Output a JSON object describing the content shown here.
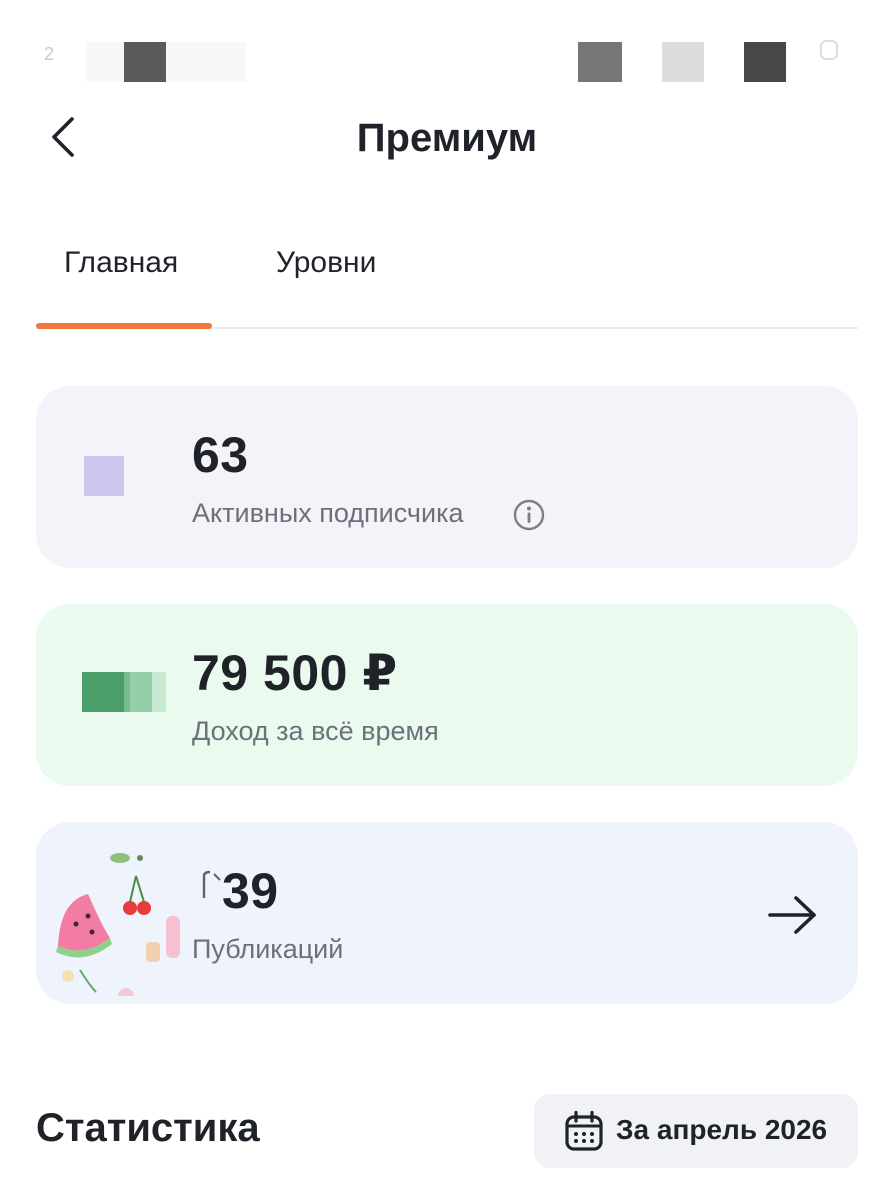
{
  "status_bar": {
    "time": "2"
  },
  "header": {
    "title": "Премиум",
    "back_icon": "chevron-left-icon"
  },
  "tabs": [
    {
      "label": "Главная",
      "active": true
    },
    {
      "label": "Уровни",
      "active": false
    }
  ],
  "accent_color": "#f0783a",
  "cards": {
    "subscribers": {
      "value": "63",
      "label": "Активных подписчика",
      "info_icon": "info-icon",
      "bg_color": "#f3f3f9"
    },
    "income": {
      "value": "79 500 ₽",
      "label": "Доход за всё время",
      "bg_color": "#eafaee"
    },
    "publications": {
      "value": "39",
      "label": "Публикаций",
      "arrow_icon": "arrow-right-icon",
      "bg_color": "#eef3fc"
    }
  },
  "statistics": {
    "title": "Статистика",
    "period_label": "За апрель 2026",
    "period_icon": "calendar-icon"
  }
}
